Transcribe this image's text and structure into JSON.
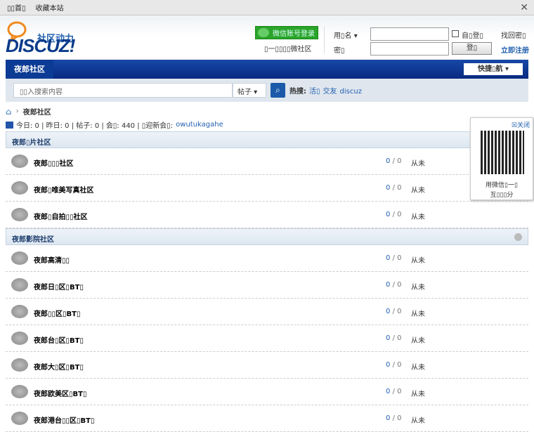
{
  "topbar": {
    "home": "▯▯首▯",
    "favorite": "收藏本站",
    "close": "✕"
  },
  "logo": {
    "brand": "DISCUZ!",
    "slogan": "社区动力"
  },
  "wechat": {
    "button": "微信账号登录",
    "sub": "▯一▯▯▯▯微社区"
  },
  "login": {
    "username_label": "用▯名",
    "password_label": "密▯",
    "remember": "自▯登▯",
    "login_button": "登▯",
    "forgot": "找回密▯",
    "register": "立即注册"
  },
  "nav": {
    "item": "夜郎社区",
    "quick": "快捷▯航 ▾"
  },
  "search": {
    "placeholder": "▯▯入搜索内容",
    "type": "帖子 ▾",
    "hot_label": "热搜:",
    "hot": [
      "活▯",
      "交友",
      "discuz"
    ]
  },
  "breadcrumb": {
    "current": "夜郎社区"
  },
  "stats": {
    "text": "今日: 0 | 昨日: 0 | 帖子: 0 | 会▯: 440 | ▯迎新会▯:",
    "newest": "owutukagahe"
  },
  "categories": [
    {
      "title": "夜郎▯片社区",
      "forums": [
        {
          "name": "夜郎▯▯▯社区",
          "today": "0",
          "total": "/ 0",
          "last": "从未"
        },
        {
          "name": "夜郎▯唯美写真社区",
          "today": "0",
          "total": "/ 0",
          "last": "从未"
        },
        {
          "name": "夜郎▯自拍▯▯社区",
          "today": "0",
          "total": "/ 0",
          "last": "从未"
        }
      ]
    },
    {
      "title": "夜郎影院社区",
      "forums": [
        {
          "name": "夜郎高清▯▯",
          "today": "0",
          "total": "/ 0",
          "last": "从未"
        },
        {
          "name": "夜郎日▯区▯BT▯",
          "today": "0",
          "total": "/ 0",
          "last": "从未"
        },
        {
          "name": "夜郎▯▯区▯BT▯",
          "today": "0",
          "total": "/ 0",
          "last": "从未"
        },
        {
          "name": "夜郎台▯区▯BT▯",
          "today": "0",
          "total": "/ 0",
          "last": "从未"
        },
        {
          "name": "夜郎大▯区▯BT▯",
          "today": "0",
          "total": "/ 0",
          "last": "从未"
        },
        {
          "name": "夜郎欧美区▯BT▯",
          "today": "0",
          "total": "/ 0",
          "last": "从未"
        },
        {
          "name": "夜郎港台▯▯区▯BT▯",
          "today": "0",
          "total": "/ 0",
          "last": "从未"
        }
      ]
    }
  ],
  "qr": {
    "close": "☒关闭",
    "line1": "用微信▯一▯",
    "line2": "互▯▯▯分"
  }
}
